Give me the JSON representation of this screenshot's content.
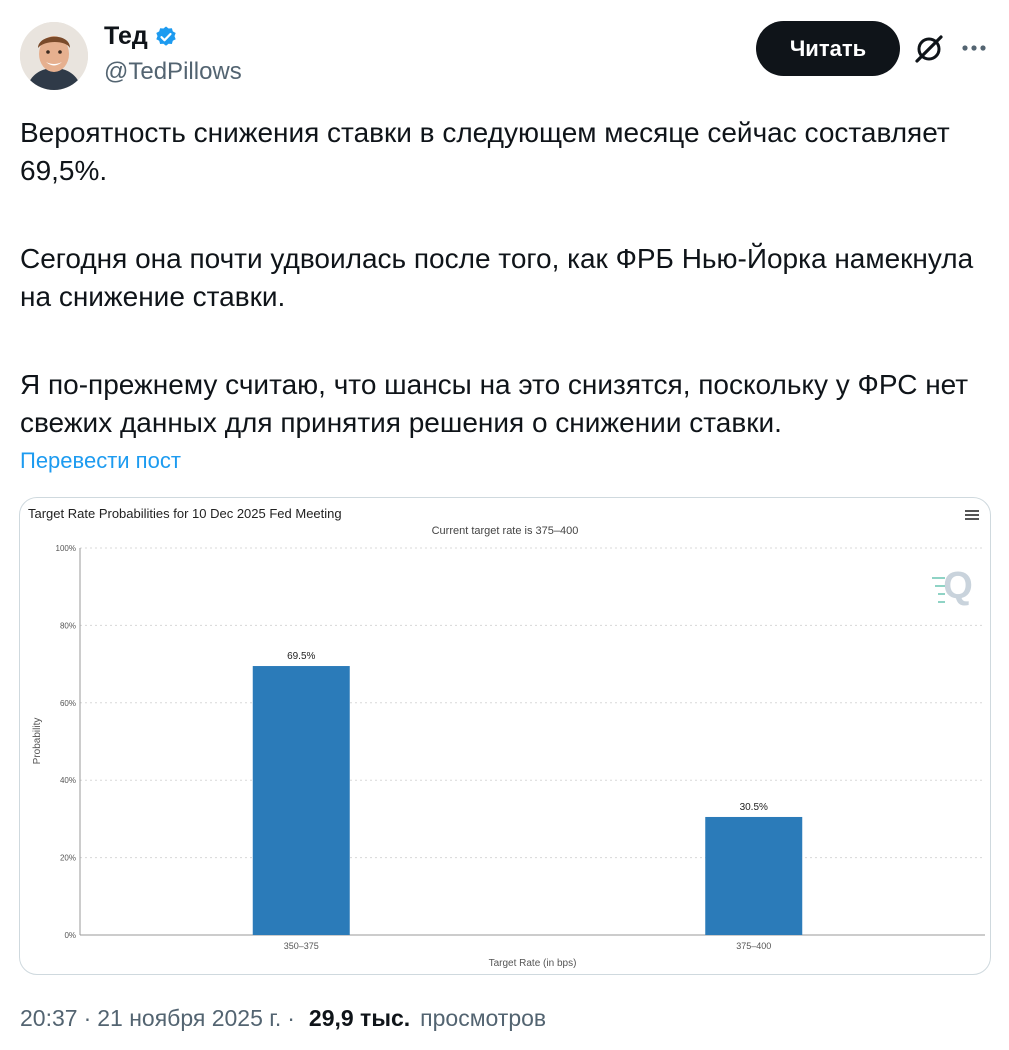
{
  "author": {
    "name": "Тед",
    "handle": "@TedPillows",
    "verified": true,
    "verified_color": "#1d9bf0"
  },
  "actions": {
    "read_label": "Читать",
    "grok_icon": "grok-icon",
    "more_icon": "more-icon"
  },
  "tweet": {
    "paragraphs": [
      "Вероятность снижения ставки в следующем месяце сейчас составляет 69,5%.",
      "Сегодня она почти удвоилась после того, как ФРБ Нью-Йорка намекнула на снижение ставки.",
      "Я по-прежнему считаю, что шансы на это снизятся, поскольку у ФРС нет свежих данных для принятия решения о снижении ставки."
    ],
    "translate_label": "Перевести пост"
  },
  "chart_data": {
    "type": "bar",
    "title": "Target Rate Probabilities for 10 Dec 2025 Fed Meeting",
    "subtitle": "Current target rate is 375–400",
    "categories": [
      "350–375",
      "375–400"
    ],
    "values": [
      69.5,
      30.5
    ],
    "data_labels": [
      "69.5%",
      "30.5%"
    ],
    "xlabel": "Target Rate (in bps)",
    "ylabel": "Probability",
    "ylim": [
      0,
      100
    ],
    "yticks": [
      "0%",
      "20%",
      "40%",
      "60%",
      "80%",
      "100%"
    ],
    "grid": true,
    "bar_color": "#2b7bb9",
    "watermark": "Q"
  },
  "meta": {
    "time": "20:37",
    "separator": "·",
    "date": "21 ноября 2025 г.",
    "views_count": "29,9 тыс.",
    "views_label": "просмотров"
  }
}
